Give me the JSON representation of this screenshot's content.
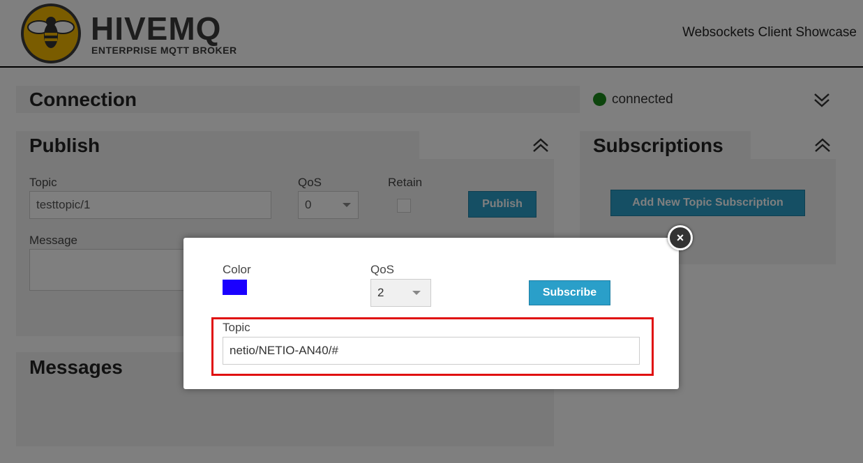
{
  "header": {
    "logo_word": "HIVEMQ",
    "logo_subtitle": "ENTERPRISE MQTT BROKER",
    "page_title": "Websockets Client Showcase"
  },
  "connection": {
    "title": "Connection",
    "status": "connected",
    "status_color": "#1a8a1a"
  },
  "publish": {
    "title": "Publish",
    "topic_label": "Topic",
    "topic_value": "testtopic/1",
    "qos_label": "QoS",
    "qos_value": "0",
    "retain_label": "Retain",
    "publish_button": "Publish",
    "message_label": "Message"
  },
  "subscriptions": {
    "title": "Subscriptions",
    "add_button": "Add New Topic Subscription"
  },
  "messages": {
    "title": "Messages"
  },
  "modal": {
    "color_label": "Color",
    "color_value": "#1a00ff",
    "qos_label": "QoS",
    "qos_value": "2",
    "subscribe_button": "Subscribe",
    "topic_label": "Topic",
    "topic_value": "netio/NETIO-AN40/#",
    "highlight_color": "#e01010",
    "close_glyph": "×"
  }
}
